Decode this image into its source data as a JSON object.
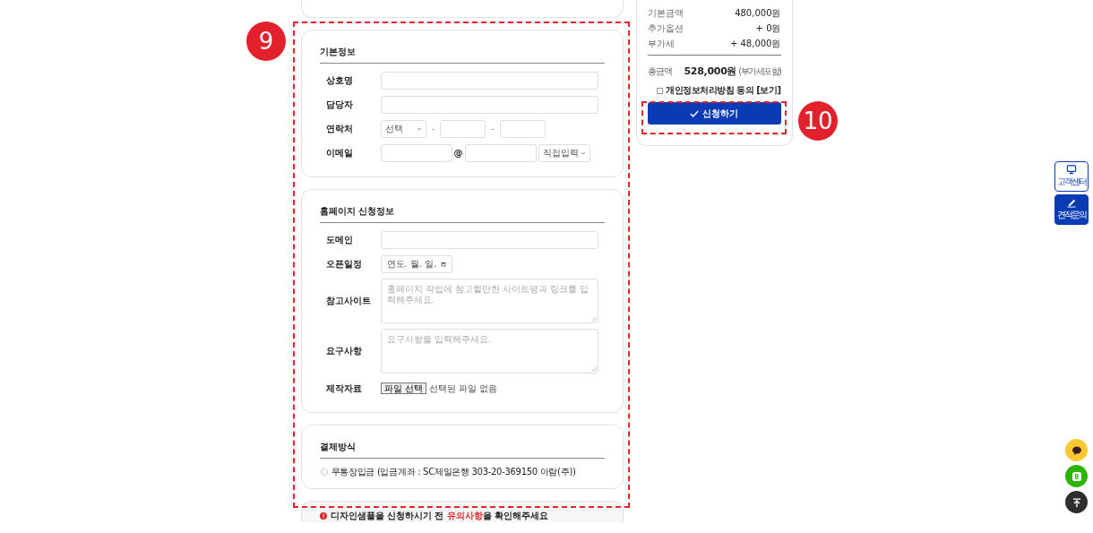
{
  "sections": [
    {
      "title": "기본정보",
      "rows": [
        {
          "kind": "text",
          "label": "상호명"
        },
        {
          "kind": "text",
          "label": "담당자"
        },
        {
          "kind": "phone",
          "label": "연락처",
          "select": "선택",
          "separators": [
            "-",
            "-"
          ]
        },
        {
          "kind": "email",
          "label": "이메일",
          "at": "@",
          "select": "직접입력"
        }
      ]
    },
    {
      "title": "홈페이지 신청정보",
      "rows": [
        {
          "kind": "text",
          "label": "도메인"
        },
        {
          "kind": "date",
          "label": "오픈일정",
          "value": "연도. 월. 일."
        },
        {
          "kind": "textarea",
          "label": "참고사이트",
          "placeholder": "홈페이지 작업에 참고할만한 사이트명과 링크를 입력해주세요."
        },
        {
          "kind": "textarea",
          "label": "요구사항",
          "placeholder": "요구사항을 입력해주세요."
        },
        {
          "kind": "file",
          "label": "제작자료",
          "button": "파일 선택",
          "status": "선택된 파일 없음"
        }
      ]
    },
    {
      "title": "결제방식",
      "rows": [
        {
          "kind": "radio",
          "label": "무통장입금 (입금계좌 : SC제일은행 303-20-369150 아람(주))",
          "selected": false
        }
      ]
    }
  ],
  "notice": [
    {
      "text": "디자인샘플을 신청하시기 전 ",
      "highlight": false
    },
    {
      "text": "유의사항",
      "highlight": true
    },
    {
      "text": "을 확인해주세요",
      "highlight": false
    }
  ],
  "summary": {
    "rows": [
      {
        "label": "기본금액",
        "value": "480,000원"
      },
      {
        "label": "추가옵션",
        "value": "+ 0원"
      },
      {
        "label": "부가세",
        "value": "+ 48,000원"
      }
    ],
    "total_label": "총금액",
    "total": "528,000원",
    "total_note": "(부가세포함)",
    "agree": {
      "label": "개인정보처리방침 동의 [보기]",
      "checked": false
    },
    "submit": "신청하기"
  },
  "side_buttons": [
    {
      "kind": "support",
      "label": "고객센터",
      "selected": false
    },
    {
      "kind": "quote",
      "label": "견적문의",
      "selected": true
    }
  ],
  "round_buttons": [
    {
      "kind": "chat"
    },
    {
      "kind": "blog"
    },
    {
      "kind": "top"
    }
  ],
  "annotations": [
    {
      "kind": "form",
      "label": "9"
    },
    {
      "kind": "button",
      "label": "10"
    }
  ]
}
